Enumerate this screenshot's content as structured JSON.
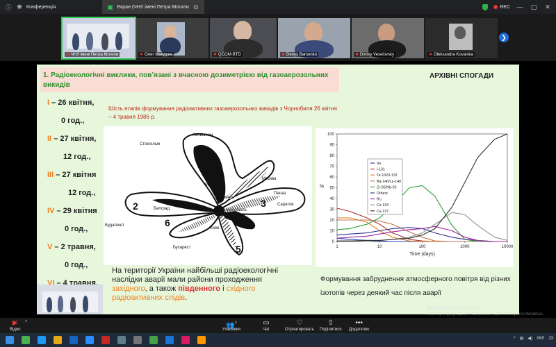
{
  "topbar": {
    "tab1_label": "Конференція",
    "tab2_label": "Екран (ЧНУ імені Петра Могили",
    "rec_label": "REC"
  },
  "gallery": {
    "participants": [
      {
        "name": "ЧНУ імені Петра Могили"
      },
      {
        "name": "Олег Мандрик"
      },
      {
        "name": "QCOM-BTD"
      },
      {
        "name": "Denys Barsenko"
      },
      {
        "name": "Dmitry Veselovsky"
      },
      {
        "name": "Oleksandra Kovalska"
      }
    ]
  },
  "slide": {
    "header": "1. Радіоекологічні виклики, пов’язані з вчасною дозиметрією  від газоаерозольних викидів",
    "archive_label": "АРХІВНІ СПОГАДИ",
    "stages_subtitle": "Шість етапів формування радіоактивних газоаерозольних викидів з Чорнобиля 26 квітня – 4 травня 1986 р.",
    "stages": [
      {
        "num": "I",
        "text": " – 26 квітня,"
      },
      {
        "num": "",
        "text": "0 год.,"
      },
      {
        "num": "II",
        "text": " – 27 квітня,"
      },
      {
        "num": "",
        "text": "12 год.,"
      },
      {
        "num": "III",
        "text": " – 27 квітня"
      },
      {
        "num": "",
        "text": "12 год.,"
      },
      {
        "num": "IV",
        "text": " – 29 квітня"
      },
      {
        "num": "",
        "text": "0 год.,"
      },
      {
        "num": "V",
        "text": " – 2 травня,"
      },
      {
        "num": "",
        "text": "0 год.,"
      },
      {
        "num": "VI",
        "text": " – 4 травня,"
      }
    ],
    "map_labels": {
      "stockholm": "Стокгольм",
      "helsinki": "Хельсинки",
      "minsk": "Минск",
      "moscow": "Москва",
      "gomel": "Гомель",
      "penza": "Пенза",
      "saratov": "Саратов",
      "chernobyl": "Чернобыль",
      "kyiv": "Киев",
      "budapest": "Будапешт",
      "bucharest": "Бухарест",
      "belgrade": "Белград"
    },
    "map_numbers": [
      "1",
      "2",
      "3",
      "4",
      "5",
      "6"
    ],
    "bottom_text_1": "На території України найбільші радіоекологічні наслідки аварії мали райони проходження ",
    "bottom_west": "західного",
    "bottom_text_2": ", а також ",
    "bottom_south": "південного",
    "bottom_text_3": " і ",
    "bottom_east": "східного радіоактивних слідів",
    "bottom_text_4": ".",
    "chart_caption": "Формування забруднення атмосферного повітря від різних ізотопів через деякий час після аварії"
  },
  "chart_data": {
    "type": "line",
    "xlabel": "Time (days)",
    "ylabel": "%",
    "xscale": "log",
    "xlim": [
      1,
      10000
    ],
    "ylim": [
      0,
      100
    ],
    "xticks": [
      1,
      10,
      100,
      1000,
      10000
    ],
    "yticks": [
      0,
      10,
      20,
      30,
      40,
      50,
      60,
      70,
      80,
      90,
      100
    ],
    "legend_position": "top-left",
    "x": [
      1,
      2,
      5,
      10,
      20,
      50,
      100,
      200,
      500,
      1000,
      2000,
      5000,
      10000
    ],
    "series": [
      {
        "name": "Xe",
        "color": "#2040c0",
        "values": [
          3,
          2,
          1,
          0.5,
          0,
          0,
          0,
          0,
          0,
          0,
          0,
          0,
          0
        ]
      },
      {
        "name": "I-131",
        "color": "#b03030",
        "values": [
          31,
          28,
          22,
          16,
          8,
          2,
          0.5,
          0,
          0,
          0,
          0,
          0,
          0
        ]
      },
      {
        "name": "Te-132/I-132",
        "color": "#e08020",
        "values": [
          22,
          22,
          18,
          10,
          4,
          0.5,
          0,
          0,
          0,
          0,
          0,
          0,
          0
        ]
      },
      {
        "name": "Ba-140/La-140",
        "color": "#c07050",
        "values": [
          20,
          20,
          20,
          19,
          16,
          9,
          4,
          0.5,
          0,
          0,
          0,
          0,
          0
        ]
      },
      {
        "name": "Zr-95/Nb-95",
        "color": "#30a030",
        "values": [
          11,
          12,
          16,
          22,
          33,
          50,
          52,
          42,
          15,
          2,
          0,
          0,
          0
        ]
      },
      {
        "name": "Others",
        "color": "#303090",
        "values": [
          6,
          7,
          8,
          10,
          12,
          13,
          12,
          8,
          4,
          2,
          1,
          0,
          0
        ]
      },
      {
        "name": "Ru",
        "color": "#a020a0",
        "values": [
          3,
          4,
          5,
          7,
          9,
          11,
          12,
          14,
          10,
          4,
          1,
          0,
          0
        ]
      },
      {
        "name": "Cs-134",
        "color": "#909090",
        "values": [
          0.5,
          0.5,
          1,
          1,
          2,
          4,
          8,
          16,
          27,
          25,
          15,
          4,
          1
        ]
      },
      {
        "name": "Cs-137",
        "color": "#303030",
        "values": [
          0.5,
          0.5,
          1,
          1,
          2,
          3,
          6,
          12,
          32,
          55,
          78,
          95,
          100
        ]
      }
    ]
  },
  "watermark": {
    "line1": "Активація Windows",
    "line2": "Перейдіть до розділу \"Настройки\", щоб активувати Windows."
  },
  "controls": {
    "video": "Відео",
    "participants": "Учасники",
    "participants_count": "7",
    "chat": "Чат",
    "reactions": "Отреагировать",
    "share": "Поділитися",
    "more": "Додатково"
  },
  "taskbar": {
    "lang": "УКР",
    "time": "23"
  }
}
